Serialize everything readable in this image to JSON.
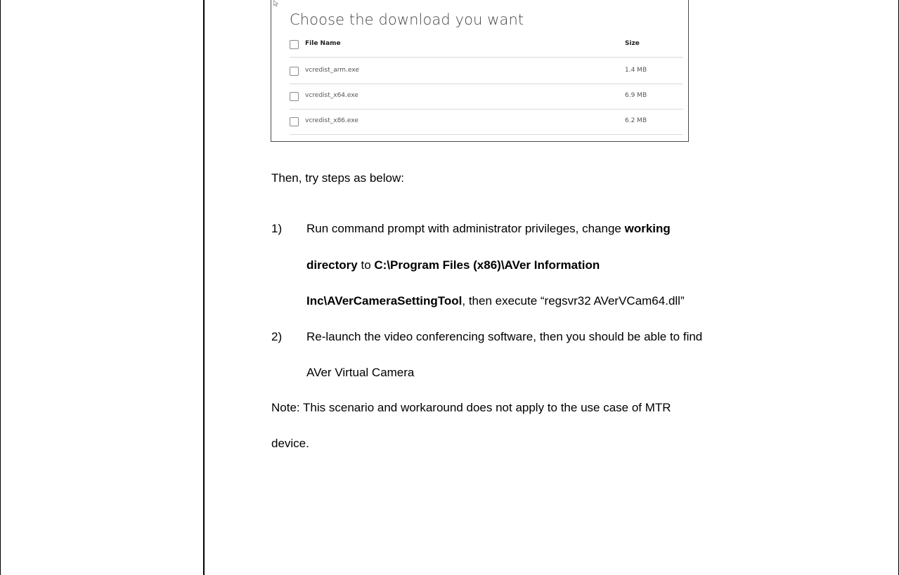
{
  "download_dialog": {
    "title": "Choose the download you want",
    "header": {
      "file_name": "File Name",
      "size": "Size"
    },
    "files": [
      {
        "name": "vcredist_arm.exe",
        "size": "1.4 MB"
      },
      {
        "name": "vcredist_x64.exe",
        "size": "6.9 MB"
      },
      {
        "name": "vcredist_x86.exe",
        "size": "6.2 MB"
      }
    ]
  },
  "content": {
    "intro": "Then, try steps as below:",
    "step1": {
      "number": "1)",
      "line1_a": "Run command prompt with administrator privileges, change ",
      "line1_b": "working",
      "line2_a": "directory",
      "line2_b": " to ",
      "line2_c": "C:\\Program Files (x86)\\AVer Information",
      "line3_a": "Inc\\AVerCameraSettingTool",
      "line3_b": ", then execute “regsvr32 AVerVCam64.dll”"
    },
    "step2": {
      "number": "2)",
      "line1": "Re-launch the video conferencing software, then you should be able to find",
      "line2": "AVer Virtual Camera"
    },
    "note_line1": "Note: This scenario and workaround does not apply to the use case of MTR",
    "note_line2": "device."
  }
}
